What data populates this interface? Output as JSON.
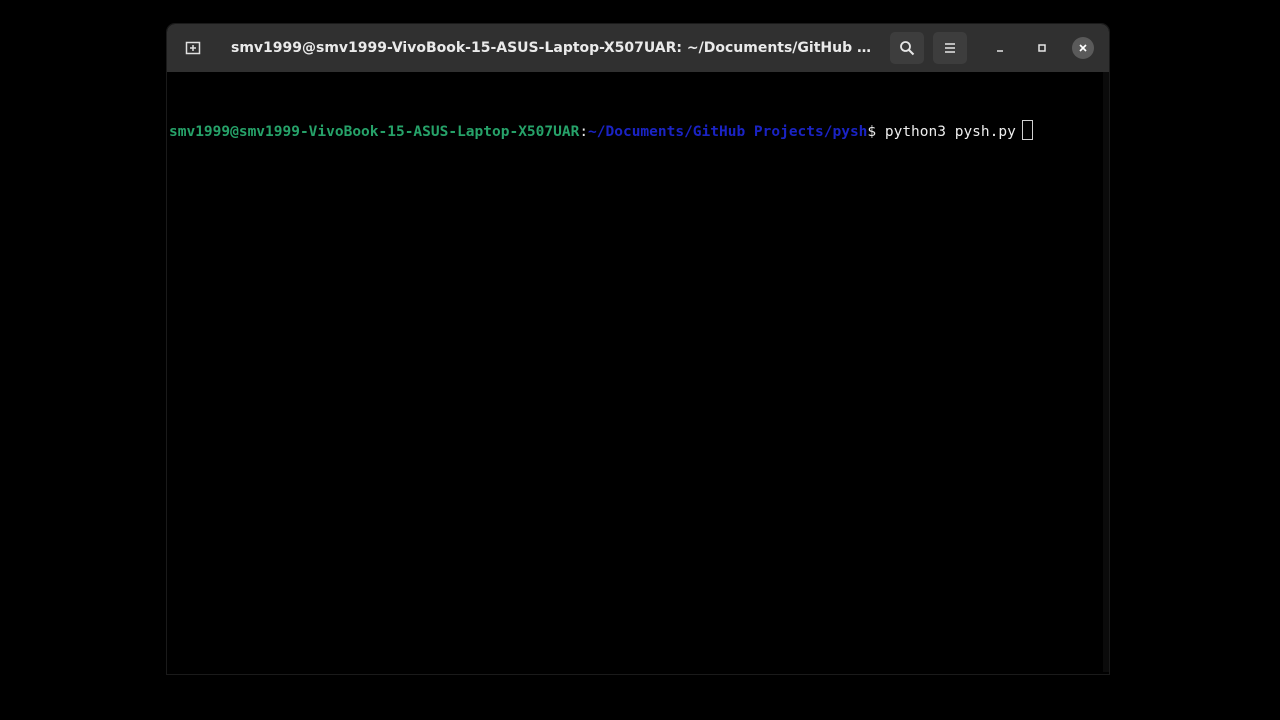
{
  "window": {
    "title": "smv1999@smv1999-VivoBook-15-ASUS-Laptop-X507UAR: ~/Documents/GitHub Projec..."
  },
  "toolbar": {
    "new_tab_icon": "new-tab-icon",
    "search_icon": "search-icon",
    "menu_icon": "hamburger-menu-icon",
    "minimize_icon": "minimize-icon",
    "maximize_icon": "maximize-icon",
    "close_icon": "close-icon"
  },
  "terminal": {
    "prompt_user_host": "smv1999@smv1999-VivoBook-15-ASUS-Laptop-X507UAR",
    "prompt_colon": ":",
    "prompt_path": "~/Documents/GitHub Projects/pysh",
    "prompt_dollar": "$",
    "command": " python3 pysh.py"
  },
  "colors": {
    "user_host": "#26a269",
    "path": "#1a23c4",
    "background": "#000000",
    "titlebar": "#303030"
  }
}
